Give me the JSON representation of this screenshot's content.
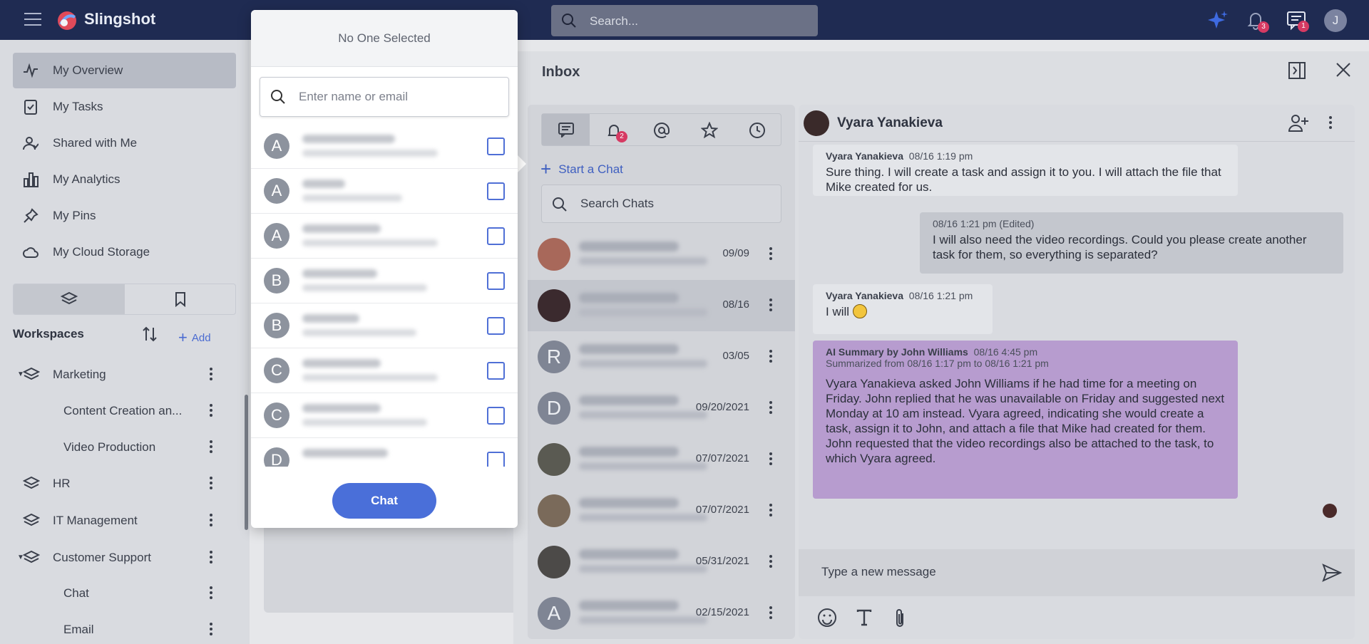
{
  "app": {
    "brand": "Slingshot"
  },
  "top": {
    "search_placeholder": "Search...",
    "notifications_count": "3",
    "inbox_count": "1",
    "user_initial": "J"
  },
  "sidebar": {
    "nav": [
      {
        "label": "My Overview",
        "icon": "pulse-icon"
      },
      {
        "label": "My Tasks",
        "icon": "task-icon"
      },
      {
        "label": "Shared with Me",
        "icon": "shared-user-icon"
      },
      {
        "label": "My Analytics",
        "icon": "bar-chart-icon"
      },
      {
        "label": "My Pins",
        "icon": "pin-icon"
      },
      {
        "label": "My Cloud Storage",
        "icon": "cloud-icon"
      }
    ],
    "workspaces_label": "Workspaces",
    "add_label": "Add",
    "tree": [
      {
        "label": "Marketing"
      },
      {
        "label": "Content Creation an..."
      },
      {
        "label": "Video Production"
      },
      {
        "label": "HR"
      },
      {
        "label": "IT Management"
      },
      {
        "label": "Customer Support"
      },
      {
        "label": "Chat"
      },
      {
        "label": "Email"
      }
    ]
  },
  "inbox": {
    "title": "Inbox",
    "notifications_tab_badge": "2",
    "start_chat_label": "Start a Chat",
    "search_chats_label": "Search Chats",
    "chats": [
      {
        "date": "09/09",
        "avatar": ""
      },
      {
        "date": "08/16",
        "avatar": ""
      },
      {
        "date": "03/05",
        "avatar": "R"
      },
      {
        "date": "09/20/2021",
        "avatar": "D"
      },
      {
        "date": "07/07/2021",
        "avatar": ""
      },
      {
        "date": "07/07/2021",
        "avatar": ""
      },
      {
        "date": "05/31/2021",
        "avatar": ""
      },
      {
        "date": "02/15/2021",
        "avatar": "A"
      }
    ],
    "conversation": {
      "name": "Vyara Yanakieva",
      "messages": [
        {
          "author": "Vyara Yanakieva",
          "time": "08/16 1:19 pm",
          "text": "Sure thing. I will create a task and assign it to you. I will attach the file that Mike created for us."
        },
        {
          "author": "",
          "time": "08/16 1:21 pm  (Edited)",
          "text": "I will also need the video recordings. Could you please create another task for them, so everything is separated?"
        },
        {
          "author": "Vyara Yanakieva",
          "time": "08/16 1:21 pm",
          "text": "I will"
        },
        {
          "author": "AI Summary by John Williams",
          "time": "08/16 4:45 pm",
          "subline": "Summarized from 08/16 1:17 pm to 08/16 1:21 pm",
          "text": "Vyara Yanakieva asked John Williams if he had time for a meeting on Friday. John replied that he was unavailable on Friday and suggested next Monday at 10 am instead. Vyara agreed, indicating she would create a task, assign it to John, and attach a file that Mike had created for them. John requested that the video recordings also be attached to the task, to which Vyara agreed."
        }
      ],
      "composer_placeholder": "Type a new message"
    }
  },
  "picker": {
    "title": "No One Selected",
    "search_placeholder": "Enter name or email",
    "contacts": [
      "A",
      "A",
      "A",
      "B",
      "B",
      "C",
      "C",
      "D"
    ],
    "button_label": "Chat"
  }
}
